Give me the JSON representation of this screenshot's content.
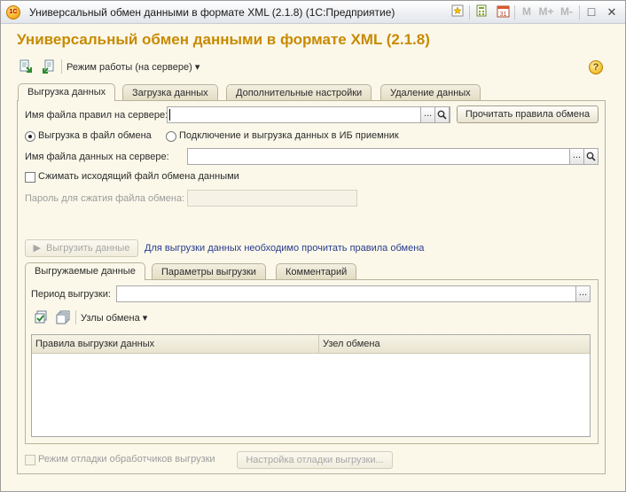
{
  "window": {
    "title": "Универсальный обмен данными в формате XML (2.1.8)  (1С:Предприятие)",
    "app_icon_text": "1С",
    "title_buttons": [
      "M",
      "M+",
      "M-"
    ]
  },
  "heading": "Универсальный обмен данными в формате XML (2.1.8)",
  "toolbar": {
    "mode_label": "Режим работы (на сервере)",
    "help_label": "?"
  },
  "main_tabs": [
    "Выгрузка данных",
    "Загрузка данных",
    "Дополнительные настройки",
    "Удаление данных"
  ],
  "export": {
    "rules_file_label": "Имя файла правил на сервере:",
    "rules_file_value": "",
    "read_rules_button": "Прочитать правила обмена",
    "radio_to_file": "Выгрузка в файл обмена",
    "radio_to_db": "Подключение и выгрузка данных в ИБ приемник",
    "data_file_label": "Имя файла данных на сервере:",
    "data_file_value": "",
    "compress_label": "Сжимать исходящий файл обмена данными",
    "password_label": "Пароль для сжатия файла обмена:",
    "export_button": "Выгрузить данные",
    "hint_link": "Для выгрузки данных необходимо прочитать правила обмена"
  },
  "sub_tabs": [
    "Выгружаемые данные",
    "Параметры выгрузки",
    "Комментарий"
  ],
  "data_tab": {
    "period_label": "Период выгрузки:",
    "period_value": "",
    "nodes_label": "Узлы обмена",
    "columns": [
      "Правила выгрузки данных",
      "Узел обмена"
    ]
  },
  "footer": {
    "debug_label": "Режим отладки обработчиков выгрузки",
    "debug_button": "Настройка отладки выгрузки..."
  },
  "glyphs": {
    "ellipsis": "...",
    "search": "🔍",
    "dropdown": "▾",
    "play": "▶",
    "restore": "□",
    "close": "✕"
  },
  "colors": {
    "heading": "#c88a00",
    "background": "#fbf8ea",
    "link": "#283c8c"
  }
}
